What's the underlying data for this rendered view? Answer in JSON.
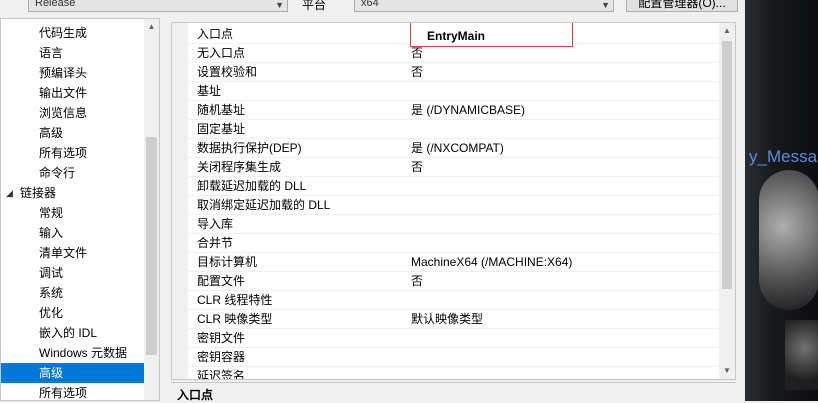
{
  "toolbar": {
    "configuration_value": "Release",
    "platform_label": "平台",
    "platform_value": "x64",
    "config_manager_label": "配置管理器(O)..."
  },
  "tree": {
    "items": [
      {
        "label": "代码生成",
        "level": 2
      },
      {
        "label": "语言",
        "level": 2
      },
      {
        "label": "预编译头",
        "level": 2
      },
      {
        "label": "输出文件",
        "level": 2
      },
      {
        "label": "浏览信息",
        "level": 2
      },
      {
        "label": "高级",
        "level": 2
      },
      {
        "label": "所有选项",
        "level": 2
      },
      {
        "label": "命令行",
        "level": 2
      },
      {
        "label": "链接器",
        "level": 1,
        "expanded": true
      },
      {
        "label": "常规",
        "level": 2
      },
      {
        "label": "输入",
        "level": 2
      },
      {
        "label": "清单文件",
        "level": 2
      },
      {
        "label": "调试",
        "level": 2
      },
      {
        "label": "系统",
        "level": 2
      },
      {
        "label": "优化",
        "level": 2
      },
      {
        "label": "嵌入的 IDL",
        "level": 2
      },
      {
        "label": "Windows 元数据",
        "level": 2
      },
      {
        "label": "高级",
        "level": 2,
        "selected": true
      },
      {
        "label": "所有选项",
        "level": 2
      }
    ]
  },
  "properties": [
    {
      "name": "入口点",
      "value": "EntryMain",
      "editing": true
    },
    {
      "name": "无入口点",
      "value": "否"
    },
    {
      "name": "设置校验和",
      "value": "否"
    },
    {
      "name": "基址",
      "value": ""
    },
    {
      "name": "随机基址",
      "value": "是 (/DYNAMICBASE)"
    },
    {
      "name": "固定基址",
      "value": ""
    },
    {
      "name": "数据执行保护(DEP)",
      "value": "是 (/NXCOMPAT)"
    },
    {
      "name": "关闭程序集生成",
      "value": "否"
    },
    {
      "name": "卸载延迟加载的 DLL",
      "value": ""
    },
    {
      "name": "取消绑定延迟加载的 DLL",
      "value": ""
    },
    {
      "name": "导入库",
      "value": ""
    },
    {
      "name": "合并节",
      "value": ""
    },
    {
      "name": "目标计算机",
      "value": "MachineX64 (/MACHINE:X64)"
    },
    {
      "name": "配置文件",
      "value": "否"
    },
    {
      "name": "CLR 线程特性",
      "value": ""
    },
    {
      "name": "CLR 映像类型",
      "value": "默认映像类型"
    },
    {
      "name": "密钥文件",
      "value": ""
    },
    {
      "name": "密钥容器",
      "value": ""
    },
    {
      "name": "延迟签名",
      "value": ""
    }
  ],
  "description": {
    "title": "入口点"
  },
  "background": {
    "text": "y_Messa"
  },
  "icons": {
    "expand": "chevron-down-icon",
    "scroll_up": "scroll-up-icon",
    "scroll_down": "scroll-down-icon"
  },
  "colors": {
    "selection": "#0078d7",
    "edit_border": "#e04040",
    "background_text": "#5a8fd8"
  }
}
